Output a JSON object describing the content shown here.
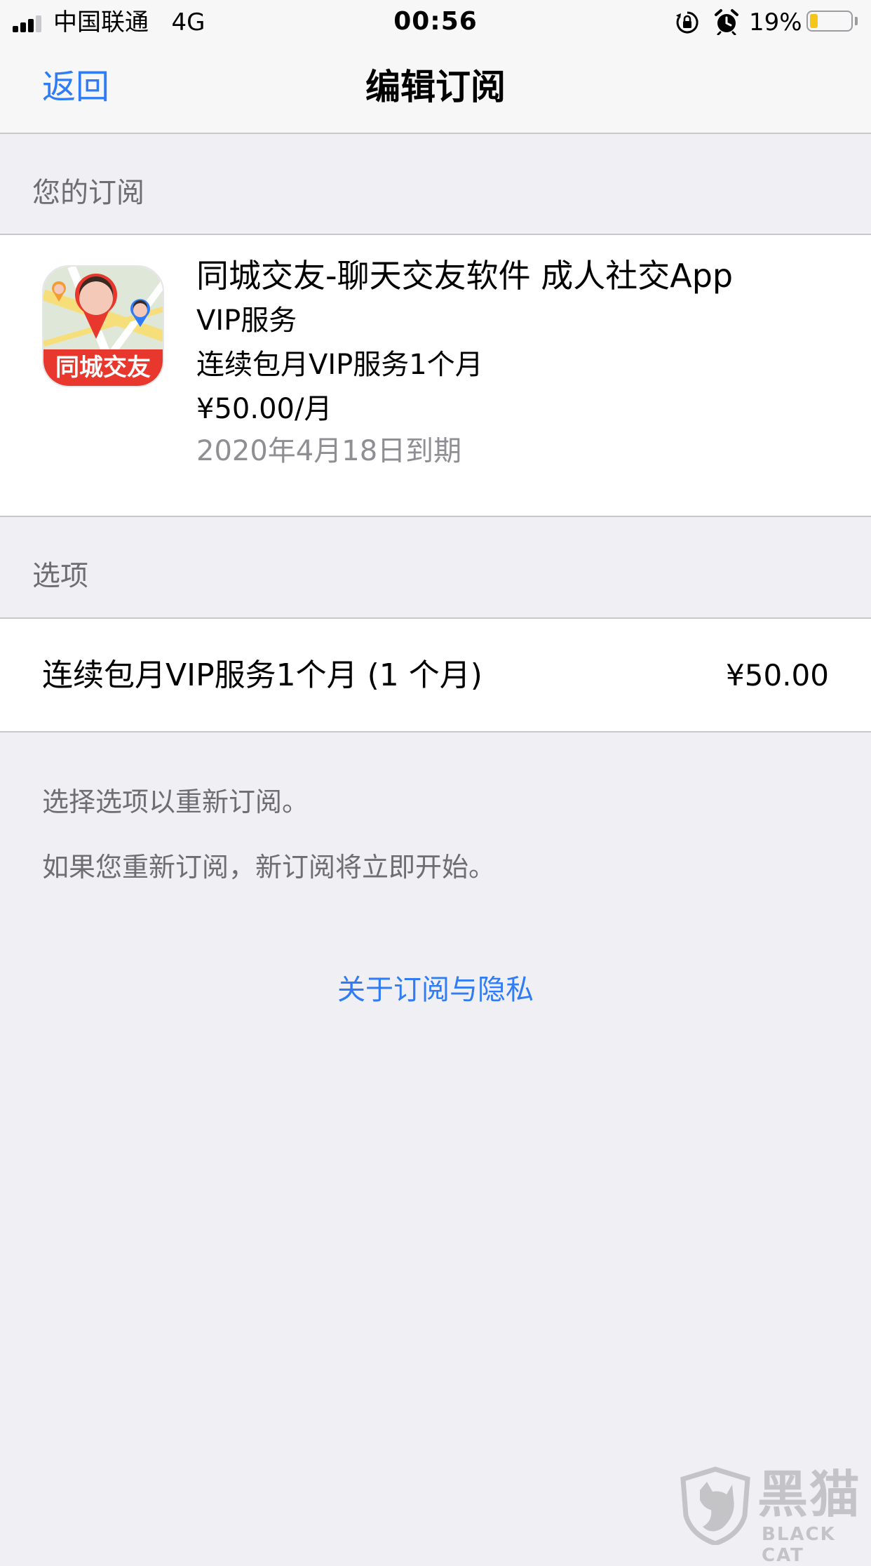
{
  "status_bar": {
    "carrier": "中国联通",
    "network": "4G",
    "time": "00:56",
    "battery_percent": "19%",
    "battery_level": 0.19,
    "battery_color": "#f5c518",
    "icons": [
      "signal-icon",
      "rotation-lock-icon",
      "alarm-icon",
      "battery-icon"
    ]
  },
  "nav": {
    "back_label": "返回",
    "title": "编辑订阅"
  },
  "subscription_section": {
    "header": "您的订阅",
    "app_icon_label": "同城交友",
    "app_name": "同城交友-聊天交友软件 成人社交App",
    "service": "VIP服务",
    "plan": "连续包月VIP服务1个月",
    "price": "¥50.00/月",
    "expiry": "2020年4月18日到期"
  },
  "options_section": {
    "header": "选项",
    "options": [
      {
        "name": "连续包月VIP服务1个月 (1 个月)",
        "price": "¥50.00"
      }
    ]
  },
  "notes": {
    "line1": "选择选项以重新订阅。",
    "line2": "如果您重新订阅，新订阅将立即开始。"
  },
  "privacy_link": "关于订阅与隐私",
  "watermark": {
    "chinese": "黑猫",
    "english": "BLACK CAT"
  },
  "colors": {
    "accent": "#2f7cf6",
    "background": "#efeff4",
    "secondary_text": "#6d6d72",
    "app_icon_red": "#e8372c"
  }
}
